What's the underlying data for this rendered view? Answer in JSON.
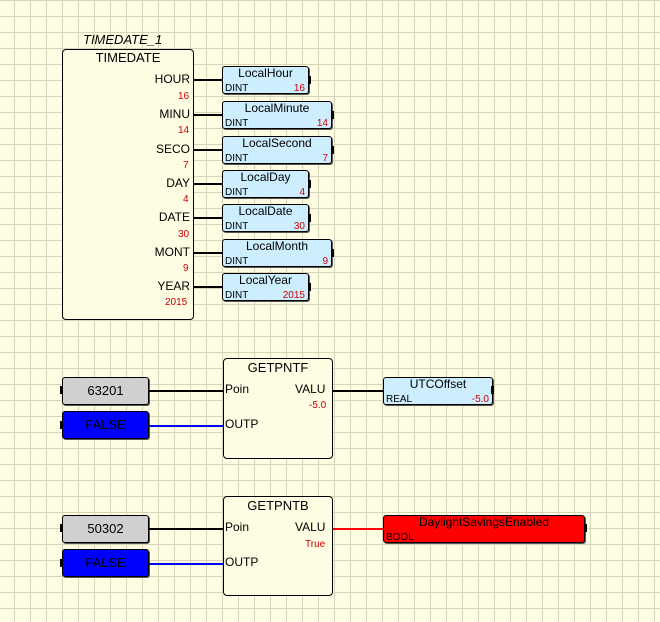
{
  "timedate_block": {
    "instance": "TIMEDATE_1",
    "type": "TIMEDATE",
    "outputs": [
      {
        "pin": "HOUR",
        "value": "16",
        "var": "LocalHour",
        "vtype": "DINT",
        "vvalue": "16"
      },
      {
        "pin": "MINU",
        "value": "14",
        "var": "LocalMinute",
        "vtype": "DINT",
        "vvalue": "14"
      },
      {
        "pin": "SECO",
        "value": "7",
        "var": "LocalSecond",
        "vtype": "DINT",
        "vvalue": "7"
      },
      {
        "pin": "DAY",
        "value": "4",
        "var": "LocalDay",
        "vtype": "DINT",
        "vvalue": "4"
      },
      {
        "pin": "DATE",
        "value": "30",
        "var": "LocalDate",
        "vtype": "DINT",
        "vvalue": "30"
      },
      {
        "pin": "MONT",
        "value": "9",
        "var": "LocalMonth",
        "vtype": "DINT",
        "vvalue": "9"
      },
      {
        "pin": "YEAR",
        "value": "2015",
        "var": "LocalYear",
        "vtype": "DINT",
        "vvalue": "2015"
      }
    ]
  },
  "getpntf_block": {
    "type": "GETPNTF",
    "in_poin_const": "63201",
    "in_outp_const": "FALSE",
    "pin_poin": "Poin",
    "pin_outp": "OUTP",
    "pin_valu": "VALU",
    "valu_value": "-5.0",
    "out_var": "UTCOffset",
    "out_type": "REAL",
    "out_value": "-5.0"
  },
  "getpntb_block": {
    "type": "GETPNTB",
    "in_poin_const": "50302",
    "in_outp_const": "FALSE",
    "pin_poin": "Poin",
    "pin_outp": "OUTP",
    "pin_valu": "VALU",
    "valu_value": "True",
    "out_var": "DaylightSavingsEnabled",
    "out_type": "BOOL",
    "out_value": ""
  },
  "colors": {
    "canvas": "#fefde4",
    "variable": "#cdeeff",
    "bool_true": "#ff0000",
    "false_const": "#0000ff",
    "const": "#d0d0d0",
    "value_text": "#d00000"
  }
}
